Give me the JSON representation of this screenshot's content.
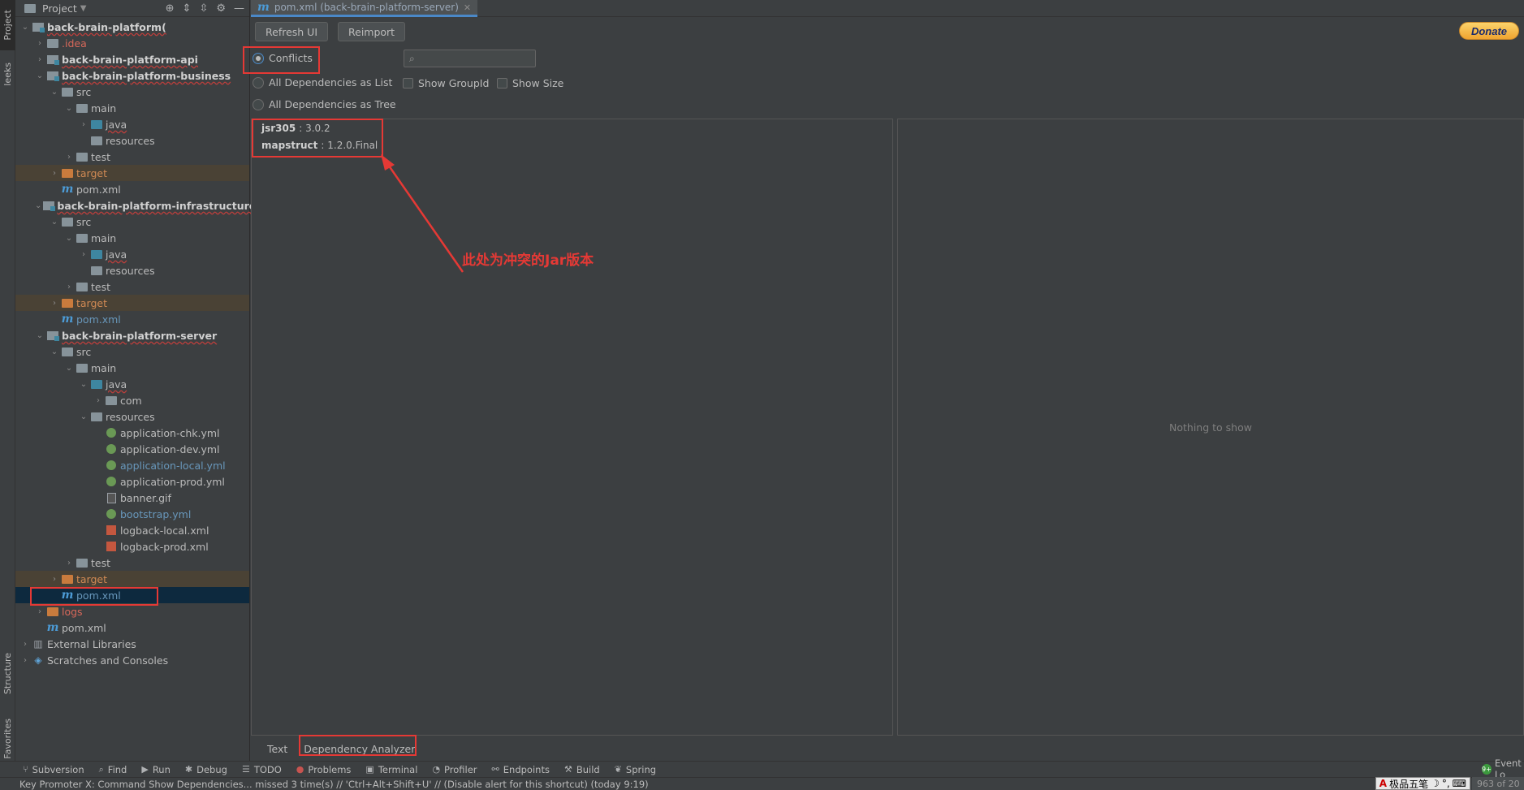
{
  "left_strip": {
    "project_label": "Project",
    "leetcode_label": "leeks",
    "structure_label": "Structure",
    "favorites_label": "Favorites"
  },
  "project_panel": {
    "title": "Project",
    "tree": [
      {
        "label": "back-brain-platform(",
        "depth": 0,
        "arrow": "open",
        "icon": "module",
        "style": "bold"
      },
      {
        "label": ".idea",
        "depth": 1,
        "arrow": "closed",
        "icon": "folder",
        "style": "red"
      },
      {
        "label": "back-brain-platform-api",
        "depth": 1,
        "arrow": "closed",
        "icon": "module",
        "style": "bold"
      },
      {
        "label": "back-brain-platform-business",
        "depth": 1,
        "arrow": "open",
        "icon": "module",
        "style": "bold"
      },
      {
        "label": "src",
        "depth": 2,
        "arrow": "open",
        "icon": "folder",
        "style": ""
      },
      {
        "label": "main",
        "depth": 3,
        "arrow": "open",
        "icon": "folder",
        "style": ""
      },
      {
        "label": "java",
        "depth": 4,
        "arrow": "closed",
        "icon": "folder-blue",
        "style": ""
      },
      {
        "label": "resources",
        "depth": 4,
        "arrow": "none",
        "icon": "folder-res",
        "style": ""
      },
      {
        "label": "test",
        "depth": 3,
        "arrow": "closed",
        "icon": "folder",
        "style": ""
      },
      {
        "label": "target",
        "depth": 2,
        "arrow": "closed",
        "icon": "folder-orange",
        "style": "orange",
        "row": "target"
      },
      {
        "label": "pom.xml",
        "depth": 2,
        "arrow": "none",
        "icon": "m",
        "style": ""
      },
      {
        "label": "back-brain-platform-infrastructure",
        "depth": 1,
        "arrow": "open",
        "icon": "module",
        "style": "bold"
      },
      {
        "label": "src",
        "depth": 2,
        "arrow": "open",
        "icon": "folder",
        "style": ""
      },
      {
        "label": "main",
        "depth": 3,
        "arrow": "open",
        "icon": "folder",
        "style": ""
      },
      {
        "label": "java",
        "depth": 4,
        "arrow": "closed",
        "icon": "folder-blue",
        "style": ""
      },
      {
        "label": "resources",
        "depth": 4,
        "arrow": "none",
        "icon": "folder-res",
        "style": ""
      },
      {
        "label": "test",
        "depth": 3,
        "arrow": "closed",
        "icon": "folder",
        "style": ""
      },
      {
        "label": "target",
        "depth": 2,
        "arrow": "closed",
        "icon": "folder-orange",
        "style": "orange",
        "row": "target"
      },
      {
        "label": "pom.xml",
        "depth": 2,
        "arrow": "none",
        "icon": "m",
        "style": "blue"
      },
      {
        "label": "back-brain-platform-server",
        "depth": 1,
        "arrow": "open",
        "icon": "module",
        "style": "bold"
      },
      {
        "label": "src",
        "depth": 2,
        "arrow": "open",
        "icon": "folder",
        "style": ""
      },
      {
        "label": "main",
        "depth": 3,
        "arrow": "open",
        "icon": "folder",
        "style": ""
      },
      {
        "label": "java",
        "depth": 4,
        "arrow": "open",
        "icon": "folder-blue",
        "style": ""
      },
      {
        "label": "com",
        "depth": 5,
        "arrow": "closed",
        "icon": "folder",
        "style": ""
      },
      {
        "label": "resources",
        "depth": 4,
        "arrow": "open",
        "icon": "folder-res",
        "style": ""
      },
      {
        "label": "application-chk.yml",
        "depth": 5,
        "arrow": "none",
        "icon": "yml",
        "style": ""
      },
      {
        "label": "application-dev.yml",
        "depth": 5,
        "arrow": "none",
        "icon": "yml",
        "style": ""
      },
      {
        "label": "application-local.yml",
        "depth": 5,
        "arrow": "none",
        "icon": "yml",
        "style": "blue"
      },
      {
        "label": "application-prod.yml",
        "depth": 5,
        "arrow": "none",
        "icon": "yml",
        "style": ""
      },
      {
        "label": "banner.gif",
        "depth": 5,
        "arrow": "none",
        "icon": "file",
        "style": ""
      },
      {
        "label": "bootstrap.yml",
        "depth": 5,
        "arrow": "none",
        "icon": "yml",
        "style": "blue"
      },
      {
        "label": "logback-local.xml",
        "depth": 5,
        "arrow": "none",
        "icon": "xml",
        "style": ""
      },
      {
        "label": "logback-prod.xml",
        "depth": 5,
        "arrow": "none",
        "icon": "xml",
        "style": ""
      },
      {
        "label": "test",
        "depth": 3,
        "arrow": "closed",
        "icon": "folder",
        "style": ""
      },
      {
        "label": "target",
        "depth": 2,
        "arrow": "closed",
        "icon": "folder-orange",
        "style": "orange",
        "row": "target"
      },
      {
        "label": "pom.xml",
        "depth": 2,
        "arrow": "none",
        "icon": "m",
        "style": "blue",
        "row": "selected"
      },
      {
        "label": "logs",
        "depth": 1,
        "arrow": "closed",
        "icon": "folder-orange",
        "style": "red"
      },
      {
        "label": "pom.xml",
        "depth": 1,
        "arrow": "none",
        "icon": "m",
        "style": ""
      },
      {
        "label": "External Libraries",
        "depth": 0,
        "arrow": "closed",
        "icon": "lib",
        "style": ""
      },
      {
        "label": "Scratches and Consoles",
        "depth": 0,
        "arrow": "closed",
        "icon": "scratch",
        "style": ""
      }
    ]
  },
  "editor_tab": {
    "label": "pom.xml (back-brain-platform-server)"
  },
  "toolbar": {
    "refresh_label": "Refresh UI",
    "reimport_label": "Reimport",
    "donate_label": "Donate"
  },
  "view_options": {
    "conflicts": "Conflicts",
    "all_list": "All Dependencies as List",
    "all_tree": "All Dependencies as Tree",
    "show_groupid": "Show GroupId",
    "show_size": "Show Size",
    "selected": "conflicts"
  },
  "search": {
    "placeholder": "",
    "value": ""
  },
  "conflicts": [
    {
      "artifact": "jsr305",
      "version": " : 3.0.2"
    },
    {
      "artifact": "mapstruct",
      "version": " : 1.2.0.Final"
    }
  ],
  "detail_pane": {
    "empty_text": "Nothing to show"
  },
  "bottom_tabs": {
    "text": "Text",
    "analyzer": "Dependency Analyzer"
  },
  "annotation": {
    "text": "此处为冲突的Jar版本",
    "color": "#e53935"
  },
  "tool_windows": [
    {
      "label": "Subversion",
      "icon": "vcs-icon"
    },
    {
      "label": "Find",
      "icon": "search-icon"
    },
    {
      "label": "Run",
      "icon": "run-icon"
    },
    {
      "label": "Debug",
      "icon": "bug-icon"
    },
    {
      "label": "TODO",
      "icon": "list-icon"
    },
    {
      "label": "Problems",
      "icon": "error-icon"
    },
    {
      "label": "Terminal",
      "icon": "terminal-icon"
    },
    {
      "label": "Profiler",
      "icon": "profiler-icon"
    },
    {
      "label": "Endpoints",
      "icon": "endpoints-icon"
    },
    {
      "label": "Build",
      "icon": "hammer-icon"
    },
    {
      "label": "Spring",
      "icon": "spring-icon"
    }
  ],
  "event_log": {
    "label": "Event Lo",
    "badge": "9+"
  },
  "status": {
    "message": "Key Promoter X: Command Show Dependencies... missed 3 time(s) // 'Ctrl+Alt+Shift+U' // (Disable alert for this shortcut) (today 9:19)",
    "position": "963 of 20",
    "ime": "极品五笔"
  }
}
